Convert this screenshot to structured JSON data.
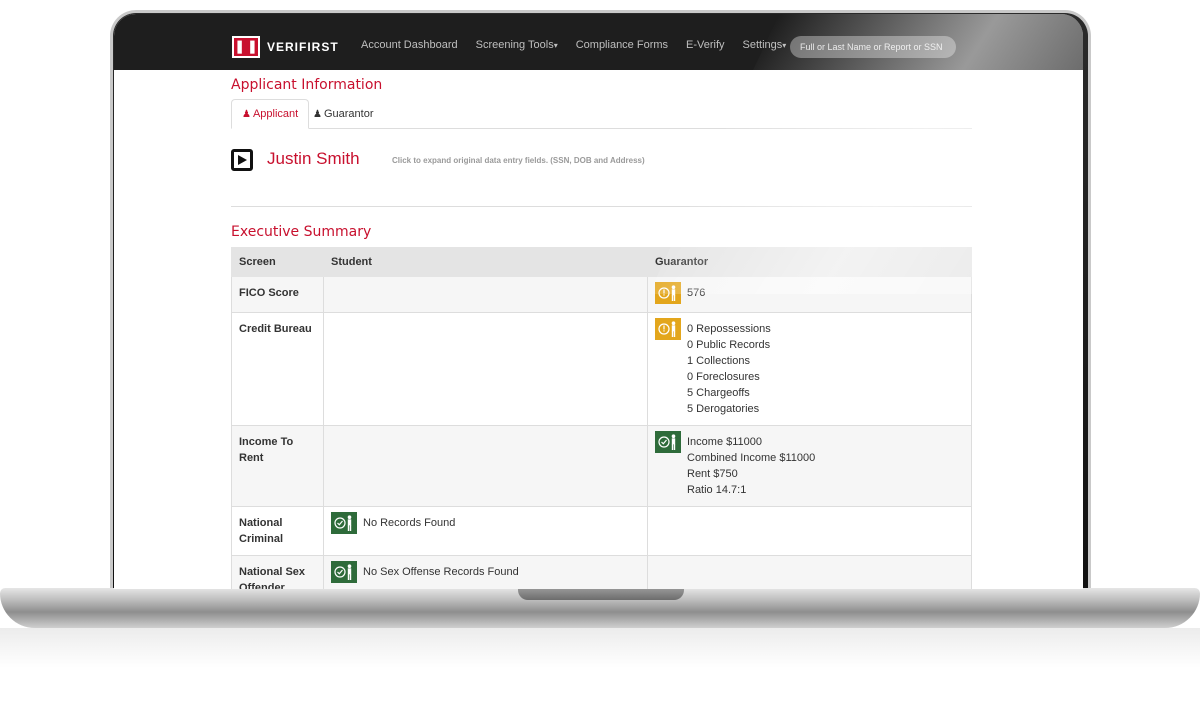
{
  "navbar": {
    "logo_text": "VERIFIRST",
    "items": [
      {
        "label": "Account Dashboard",
        "caret": false
      },
      {
        "label": "Screening Tools",
        "caret": true
      },
      {
        "label": "Compliance Forms",
        "caret": false
      },
      {
        "label": "E-Verify",
        "caret": false
      },
      {
        "label": "Settings",
        "caret": true
      }
    ],
    "search_placeholder": "Full or Last Name or Report or SSN"
  },
  "applicant_section": {
    "title": "Applicant Information",
    "tabs": [
      {
        "label": "Applicant",
        "icon": "user-icon",
        "active": true
      },
      {
        "label": "Guarantor",
        "icon": "user-icon",
        "active": false
      }
    ],
    "name": "Justin Smith",
    "expand_hint": "Click to expand original data entry fields. (SSN, DOB and Address)"
  },
  "summary": {
    "title": "Executive Summary",
    "columns": [
      "Screen",
      "Student",
      "Guarantor"
    ],
    "rows": [
      {
        "screen": "FICO Score",
        "student": null,
        "guarantor": {
          "status": "warning",
          "lines": [
            "576"
          ]
        }
      },
      {
        "screen": "Credit Bureau",
        "student": null,
        "guarantor": {
          "status": "warning",
          "lines": [
            "0 Repossessions",
            "0 Public Records",
            "1 Collections",
            "0 Foreclosures",
            "5 Chargeoffs",
            "5 Derogatories"
          ]
        }
      },
      {
        "screen": "Income To Rent",
        "student": null,
        "guarantor": {
          "status": "ok",
          "lines": [
            "Income $11000",
            "Combined Income $11000",
            "Rent $750",
            "Ratio 14.7:1"
          ]
        }
      },
      {
        "screen": "National Criminal",
        "student": {
          "status": "ok",
          "lines": [
            "No Records Found"
          ]
        },
        "guarantor": null
      },
      {
        "screen": "National Sex Offender",
        "student": {
          "status": "ok",
          "lines": [
            "No Sex Offense Records Found"
          ]
        },
        "guarantor": null
      }
    ]
  },
  "colors": {
    "accent_red": "#c8102e",
    "warning": "#e3a61c",
    "ok": "#2e6b3a",
    "navbar": "#1e1e1e"
  }
}
